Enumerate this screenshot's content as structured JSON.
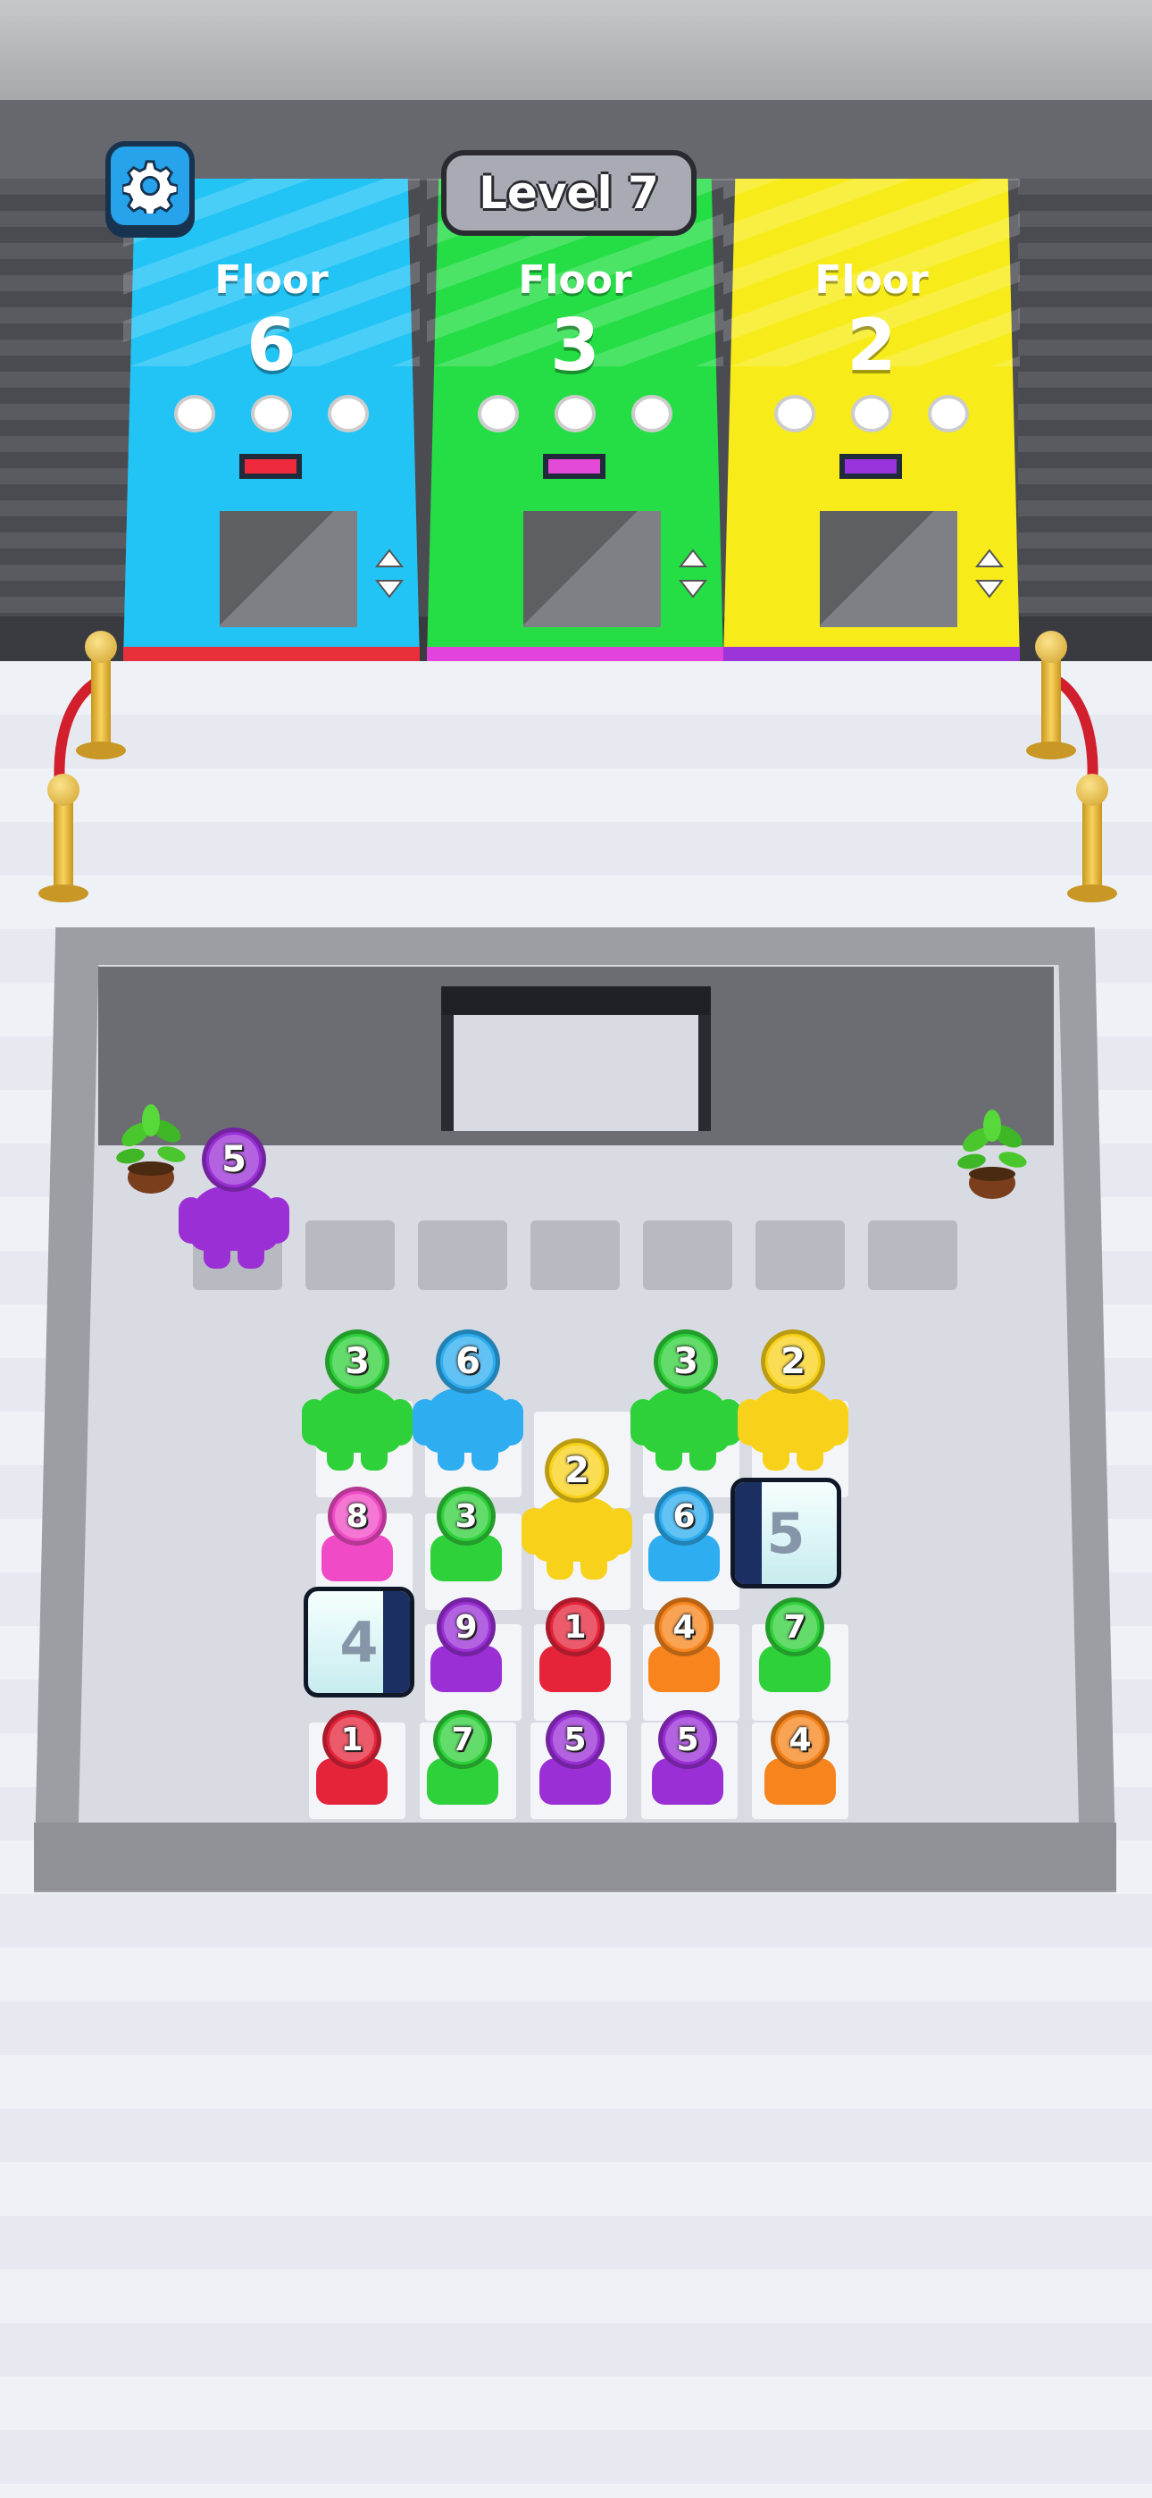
{
  "hud": {
    "level_label": "Level 7",
    "settings_icon": "gear-icon"
  },
  "elevators": [
    {
      "label": "Floor",
      "floor": "6",
      "color": "#22c4f5",
      "indicator_color": "#ef2a3c",
      "stripe_color": "#e8303a",
      "slots_filled": 0,
      "slots_total": 3
    },
    {
      "label": "Floor",
      "floor": "3",
      "color": "#25de45",
      "indicator_color": "#e34ad7",
      "stripe_color": "#e243dc",
      "slots_filled": 0,
      "slots_total": 3
    },
    {
      "label": "Floor",
      "floor": "2",
      "color": "#f7ec1a",
      "indicator_color": "#9933dd",
      "stripe_color": "#9c35d8",
      "slots_filled": 0,
      "slots_total": 3
    }
  ],
  "queue": {
    "walking_person": {
      "number": "5",
      "color": "#9a2fd6"
    },
    "slot_count": 7
  },
  "colors": {
    "green": "#2fd13a",
    "blue": "#2eaef0",
    "yellow": "#f8d21a",
    "pink": "#f04ac6",
    "purple": "#9a2fd6",
    "red": "#e5243a",
    "orange": "#f7841c",
    "ice_bar": "#1c2f63"
  },
  "grid": {
    "standing": [
      {
        "number": "3",
        "color": "green"
      },
      {
        "number": "6",
        "color": "blue"
      },
      {
        "number": "3",
        "color": "green"
      },
      {
        "number": "2",
        "color": "yellow"
      },
      {
        "number": "2",
        "color": "yellow"
      }
    ],
    "seated": [
      {
        "number": "8",
        "color": "pink"
      },
      {
        "number": "3",
        "color": "green"
      },
      {
        "number": "6",
        "color": "blue"
      },
      {
        "number": "9",
        "color": "purple"
      },
      {
        "number": "1",
        "color": "red"
      },
      {
        "number": "4",
        "color": "orange"
      },
      {
        "number": "7",
        "color": "green"
      },
      {
        "number": "1",
        "color": "red"
      },
      {
        "number": "7",
        "color": "green"
      },
      {
        "number": "5",
        "color": "purple"
      },
      {
        "number": "5",
        "color": "purple"
      },
      {
        "number": "4",
        "color": "orange"
      }
    ],
    "ice_blocks": [
      {
        "number": "5"
      },
      {
        "number": "4"
      }
    ]
  }
}
